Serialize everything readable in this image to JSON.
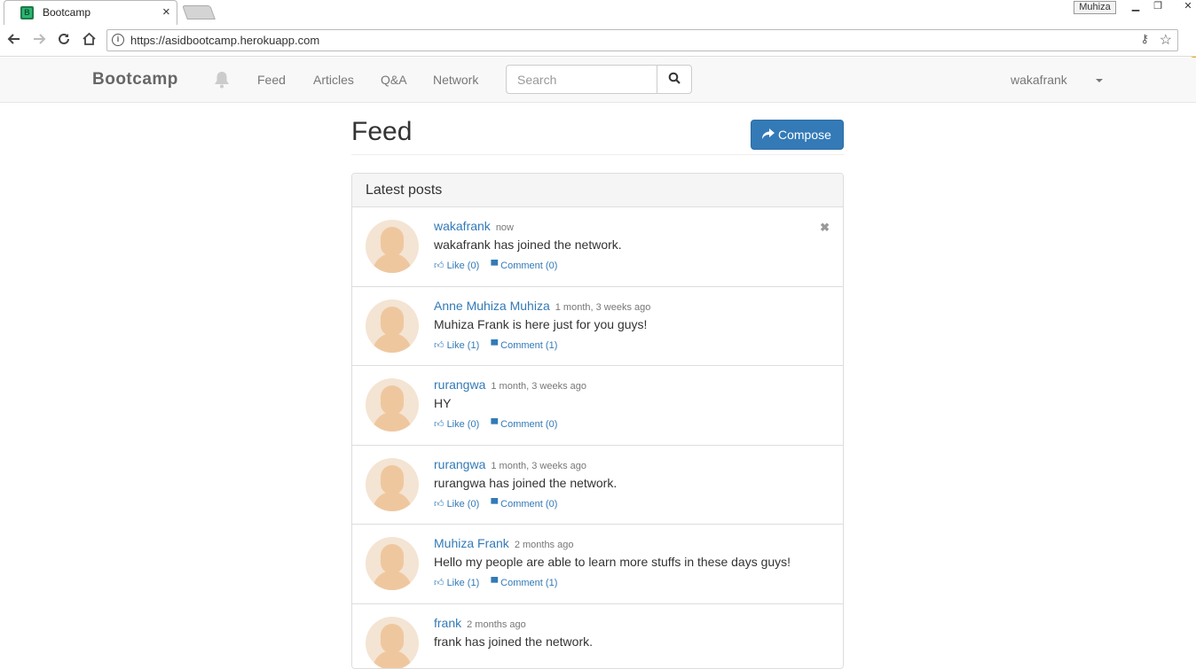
{
  "browser": {
    "tab_title": "Bootcamp",
    "url": "https://asidbootcamp.herokuapp.com",
    "profile_name": "Muhiza"
  },
  "navbar": {
    "brand": "Bootcamp",
    "links": [
      "Feed",
      "Articles",
      "Q&A",
      "Network"
    ],
    "search_placeholder": "Search",
    "username": "wakafrank"
  },
  "page": {
    "title": "Feed",
    "compose_label": "Compose",
    "panel_heading": "Latest posts"
  },
  "posts": [
    {
      "author": "wakafrank",
      "time": "now",
      "text": "wakafrank has joined the network.",
      "like": "Like (0)",
      "comment": "Comment (0)"
    },
    {
      "author": "Anne Muhiza Muhiza",
      "time": "1 month, 3 weeks ago",
      "text": "Muhiza Frank is here just for you guys!",
      "like": "Like (1)",
      "comment": "Comment (1)"
    },
    {
      "author": "rurangwa",
      "time": "1 month, 3 weeks ago",
      "text": "HY",
      "like": "Like (0)",
      "comment": "Comment (0)"
    },
    {
      "author": "rurangwa",
      "time": "1 month, 3 weeks ago",
      "text": "rurangwa has joined the network.",
      "like": "Like (0)",
      "comment": "Comment (0)"
    },
    {
      "author": "Muhiza Frank",
      "time": "2 months ago",
      "text": "Hello my people are able to learn more stuffs in these days guys!",
      "like": "Like (1)",
      "comment": "Comment (1)"
    },
    {
      "author": "frank",
      "time": "2 months ago",
      "text": "frank has joined the network.",
      "like": "",
      "comment": ""
    }
  ]
}
